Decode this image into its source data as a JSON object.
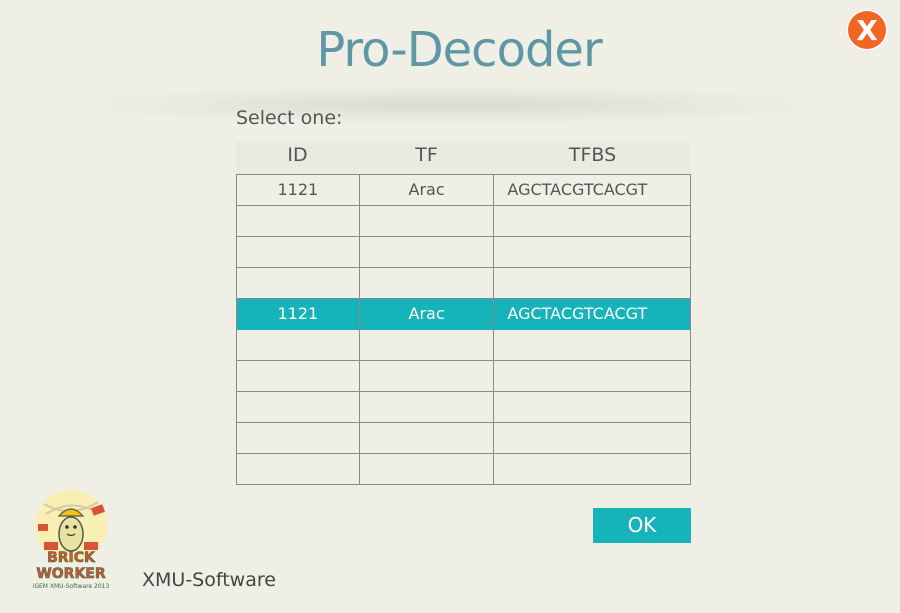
{
  "window": {
    "title": "Pro-Decoder",
    "close_label": "X"
  },
  "dialog": {
    "prompt": "Select one:",
    "columns": [
      "ID",
      "TF",
      "TFBS"
    ],
    "rows": [
      {
        "id": "1121",
        "tf": "Arac",
        "tfbs": "AGCTACGTCACGT"
      },
      {
        "id": "",
        "tf": "",
        "tfbs": ""
      },
      {
        "id": "",
        "tf": "",
        "tfbs": ""
      },
      {
        "id": "",
        "tf": "",
        "tfbs": ""
      },
      {
        "id": "1121",
        "tf": "Arac",
        "tfbs": "AGCTACGTCACGT"
      },
      {
        "id": "",
        "tf": "",
        "tfbs": ""
      },
      {
        "id": "",
        "tf": "",
        "tfbs": ""
      },
      {
        "id": "",
        "tf": "",
        "tfbs": ""
      },
      {
        "id": "",
        "tf": "",
        "tfbs": ""
      },
      {
        "id": "",
        "tf": "",
        "tfbs": ""
      }
    ],
    "selected_row": 4,
    "ok_label": "OK"
  },
  "footer": {
    "logo_line1": "BRICK",
    "logo_line2": "WORKER",
    "logo_caption": "iGEM XMU-Software 2013",
    "company": "XMU-Software"
  },
  "colors": {
    "accent": "#17b3ba",
    "close": "#f26522",
    "title": "#5f97a5",
    "background": "#f0efe6"
  }
}
